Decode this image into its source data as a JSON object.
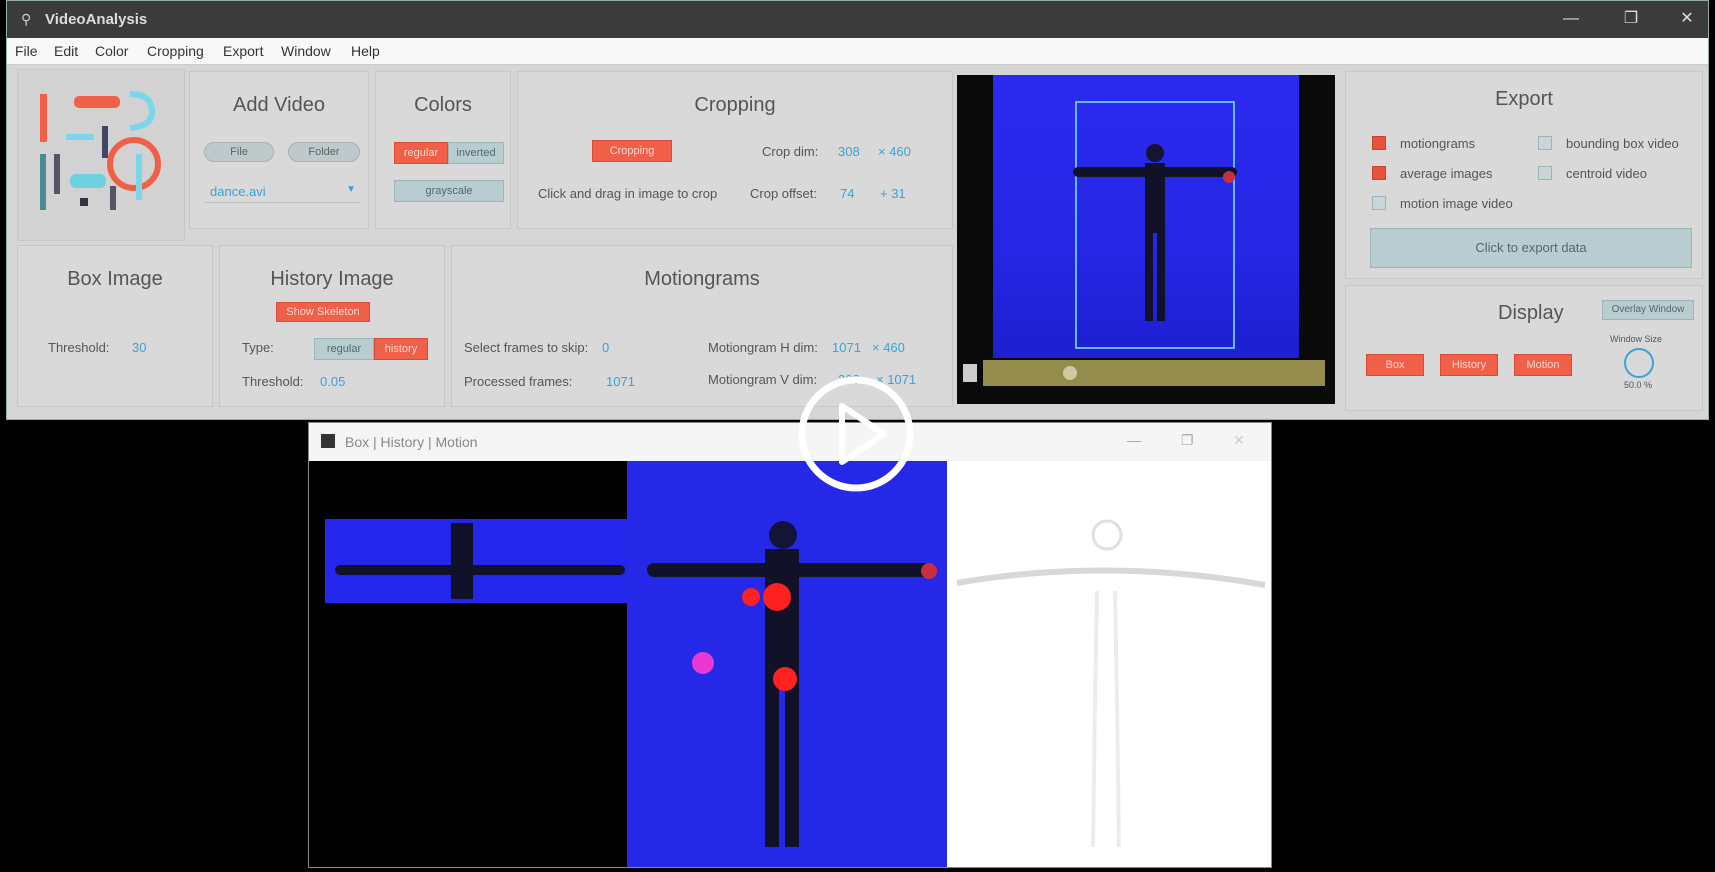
{
  "window": {
    "title": "VideoAnalysis",
    "minimize": "—",
    "maximize": "❐",
    "close": "✕"
  },
  "menu": [
    "File",
    "Edit",
    "Color",
    "Cropping",
    "Export",
    "Window",
    "Help"
  ],
  "add_video": {
    "title": "Add Video",
    "file_btn": "File",
    "folder_btn": "Folder",
    "selected": "dance.avi"
  },
  "colors": {
    "title": "Colors",
    "regular": "regular",
    "inverted": "inverted",
    "grayscale": "grayscale"
  },
  "cropping": {
    "title": "Cropping",
    "button": "Cropping",
    "hint": "Click and drag in image to crop",
    "dim_label": "Crop dim:",
    "dim_w": "308",
    "dim_h": "× 460",
    "offset_label": "Crop offset:",
    "offset_x": "74",
    "offset_y": "+ 31"
  },
  "box_image": {
    "title": "Box Image",
    "threshold_label": "Threshold:",
    "threshold": "30"
  },
  "history_image": {
    "title": "History Image",
    "button": "Show Skeleton",
    "type_label": "Type:",
    "type_regular": "regular",
    "type_history": "history",
    "threshold_label": "Threshold:",
    "threshold": "0.05"
  },
  "motiongrams": {
    "title": "Motiongrams",
    "skip_label": "Select frames to skip:",
    "skip": "0",
    "processed_label": "Processed frames:",
    "processed": "1071",
    "h_label": "Motiongram H dim:",
    "h_w": "1071",
    "h_h": "× 460",
    "v_label": "Motiongram V dim:",
    "v_w": "308",
    "v_h": "× 1071"
  },
  "export": {
    "title": "Export",
    "options": [
      {
        "label": "motiongrams",
        "checked": true
      },
      {
        "label": "bounding box video",
        "checked": false
      },
      {
        "label": "average images",
        "checked": true
      },
      {
        "label": "centroid video",
        "checked": false
      },
      {
        "label": "motion image video",
        "checked": false
      }
    ],
    "button": "Click to export data"
  },
  "display": {
    "title": "Display",
    "overlay_button": "Overlay Window",
    "box": "Box",
    "history": "History",
    "motion": "Motion",
    "window_size_label": "Window Size",
    "window_size": "50.0 %"
  },
  "sub_window": {
    "title": "Box | History | Motion"
  },
  "colors_hex": {
    "accent": "#f06048",
    "value": "#3aa3d8",
    "video_blue": "#2a2bf0"
  },
  "play_icon": "play-circle-icon"
}
